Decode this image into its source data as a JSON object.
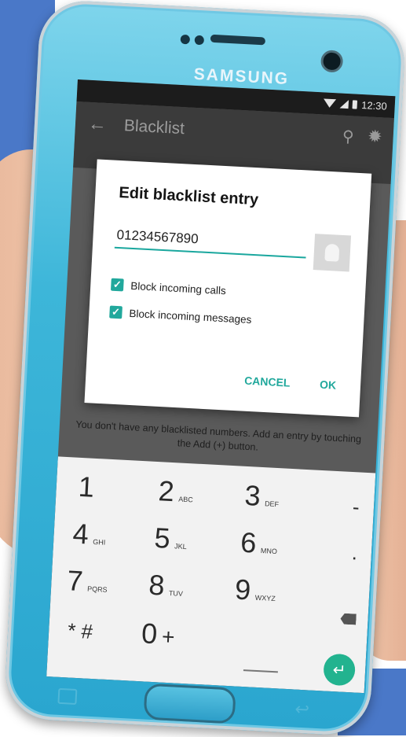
{
  "phone": {
    "brand": "SAMSUNG"
  },
  "status_bar": {
    "time": "12:30"
  },
  "app_bar": {
    "title": "Blacklist",
    "back_icon": "arrow-left-icon",
    "search_icon": "search-icon",
    "settings_icon": "gear-icon"
  },
  "empty_state": {
    "message": "You don't have any blacklisted numbers. Add an entry by touching the Add (+) button."
  },
  "dialog": {
    "title": "Edit blacklist entry",
    "number_value": "01234567890",
    "options": [
      {
        "label": "Block incoming calls",
        "checked": true
      },
      {
        "label": "Block incoming messages",
        "checked": true
      }
    ],
    "cancel_label": "CANCEL",
    "ok_label": "OK"
  },
  "keypad": {
    "keys": [
      {
        "digit": "1",
        "letters": ""
      },
      {
        "digit": "2",
        "letters": "ABC"
      },
      {
        "digit": "3",
        "letters": "DEF"
      },
      {
        "digit": "4",
        "letters": "GHI"
      },
      {
        "digit": "5",
        "letters": "JKL"
      },
      {
        "digit": "6",
        "letters": "MNO"
      },
      {
        "digit": "7",
        "letters": "PQRS"
      },
      {
        "digit": "8",
        "letters": "TUV"
      },
      {
        "digit": "9",
        "letters": "WXYZ"
      },
      {
        "digit": "0",
        "letters": "+"
      }
    ],
    "symbols": "* #",
    "minus": "-",
    "dot": "."
  },
  "colors": {
    "accent": "#21a89c",
    "phone_body": "#3db6d9",
    "background_accent": "#4a78c8"
  }
}
